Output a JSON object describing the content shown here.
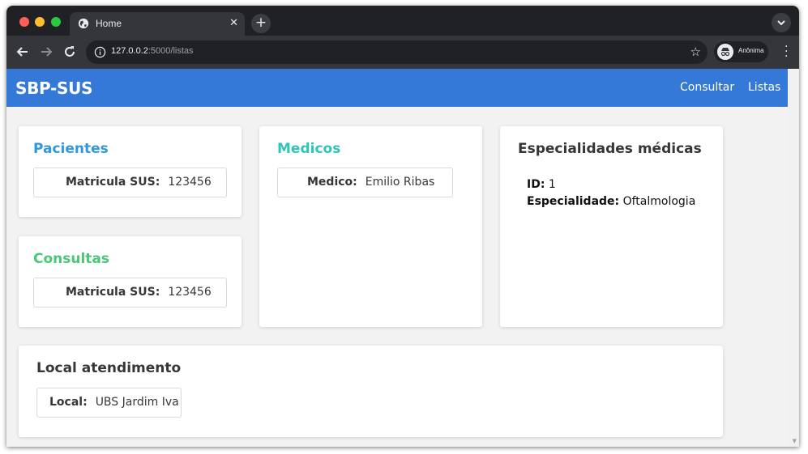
{
  "browser": {
    "tab_title": "Home",
    "tab_close": "✕",
    "new_tab": "+",
    "url_host": "127.0.0.2",
    "url_path": ":5000/listas",
    "profile_label": "Anônima"
  },
  "navbar": {
    "brand": "SBP-SUS",
    "links": [
      {
        "label": "Consultar"
      },
      {
        "label": "Listas"
      }
    ],
    "color": "#3478d8"
  },
  "cards": {
    "pacientes": {
      "title": "Pacientes",
      "title_color": "#3298dc",
      "field_label": "Matricula SUS:",
      "field_value": "123456"
    },
    "consultas": {
      "title": "Consultas",
      "title_color": "#48c774",
      "field_label": "Matricula SUS:",
      "field_value": "123456"
    },
    "medicos": {
      "title": "Medicos",
      "title_color": "#2fc5b7",
      "field_label": "Medico:",
      "field_value": "Emilio Ribas"
    },
    "especialidades": {
      "title": "Especialidades médicas",
      "title_color": "#363636",
      "id_label": "ID:",
      "id_value": "1",
      "spec_label": "Especialidade:",
      "spec_value": "Oftalmologia"
    },
    "local": {
      "title": "Local atendimento",
      "title_color": "#363636",
      "field_label": "Local:",
      "field_value": "UBS Jardim Iva"
    }
  }
}
